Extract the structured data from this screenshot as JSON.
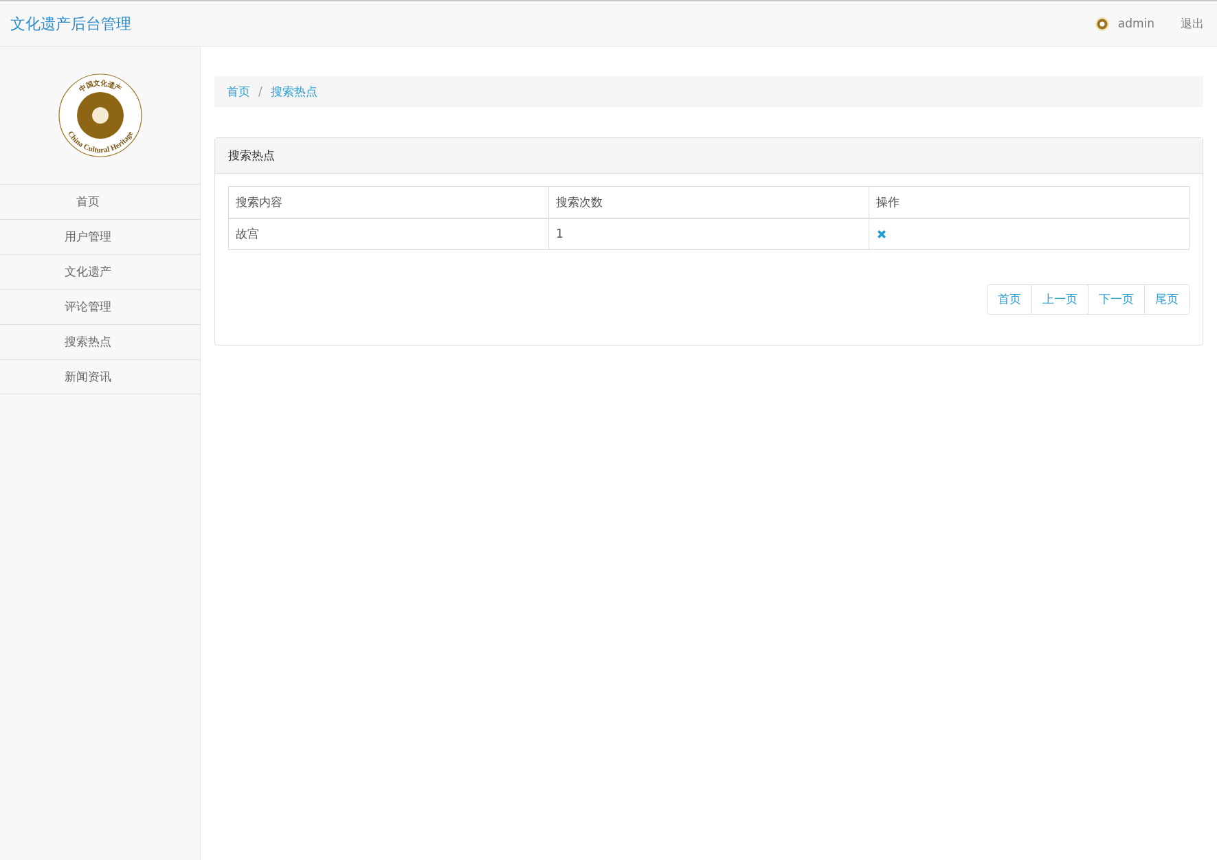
{
  "header": {
    "title": "文化遗产后台管理",
    "user": "admin",
    "logout": "退出"
  },
  "sidebar": {
    "logo": {
      "top_text": "中国文化遗产",
      "bottom_text": "China Cultural Heritage"
    },
    "items": [
      {
        "label": "首页"
      },
      {
        "label": "用户管理"
      },
      {
        "label": "文化遗产"
      },
      {
        "label": "评论管理"
      },
      {
        "label": "搜索热点"
      },
      {
        "label": "新闻资讯"
      }
    ]
  },
  "breadcrumb": {
    "separator": "/",
    "items": [
      "首页",
      "搜索热点"
    ]
  },
  "panel": {
    "title": "搜索热点",
    "table": {
      "columns": [
        "搜索内容",
        "搜索次数",
        "操作"
      ],
      "rows": [
        {
          "content": "故宫",
          "count": "1"
        }
      ]
    },
    "pagination": [
      "首页",
      "上一页",
      "下一页",
      "尾页"
    ]
  }
}
